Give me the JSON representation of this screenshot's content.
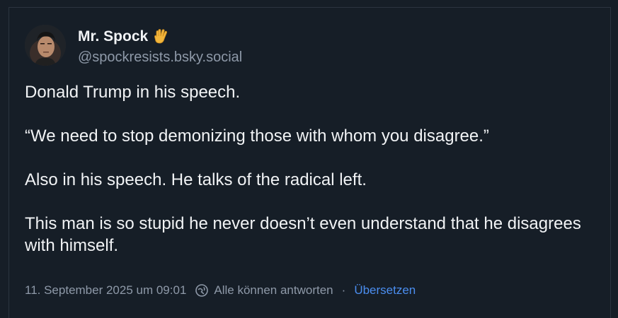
{
  "post": {
    "author": {
      "display_name": "Mr. Spock",
      "name_emoji": "vulcan-salute-icon",
      "handle": "@spockresists.bsky.social"
    },
    "paragraphs": [
      "Donald Trump in his speech.",
      "“We need to stop demonizing those with whom you disagree.”",
      "Also in his speech. He talks of the radical left.",
      "This man is so stupid he never doesn’t even understand that he disagrees with himself."
    ],
    "meta": {
      "timestamp": "11. September 2025 um 09:01",
      "reply_setting_icon": "reply-settings-icon",
      "reply_setting": "Alle können antworten",
      "separator": "·",
      "translate_label": "Übersetzen"
    }
  },
  "colors": {
    "background": "#161e27",
    "border": "#2b3440",
    "text_primary": "#f1f3f5",
    "text_secondary": "#8e99a8",
    "link": "#4b8ef0"
  }
}
